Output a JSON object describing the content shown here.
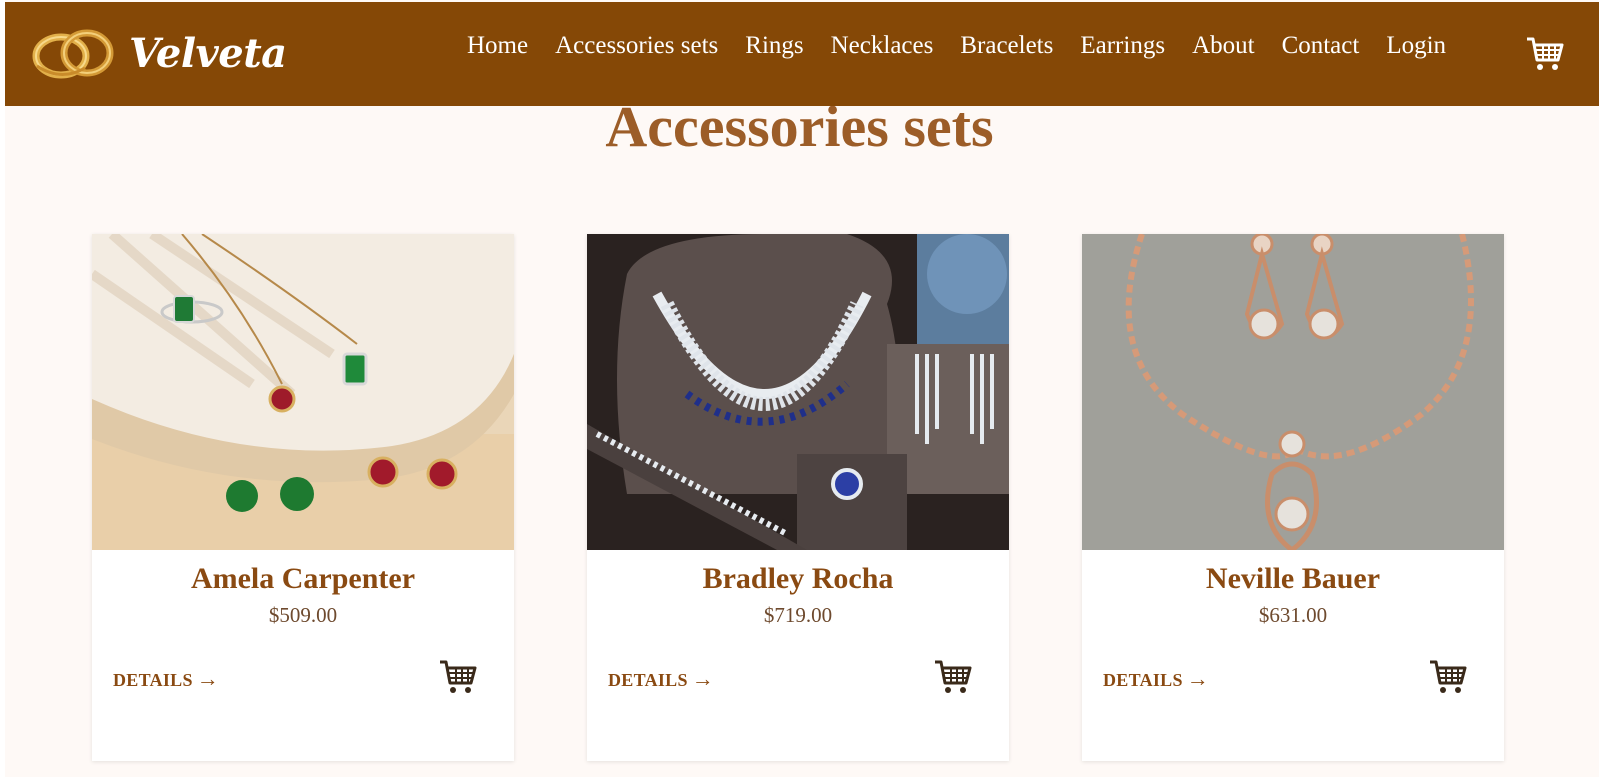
{
  "brand": {
    "name": "Velveta"
  },
  "nav": {
    "items": [
      "Home",
      "Accessories sets",
      "Rings",
      "Necklaces",
      "Bracelets",
      "Earrings",
      "About",
      "Contact",
      "Login"
    ],
    "cart_icon": "cart-icon"
  },
  "page": {
    "title": "Accessories sets"
  },
  "products": [
    {
      "name": "Amela Carpenter",
      "price": "$509.00",
      "details_label": "DETAILS",
      "arrow": "→",
      "image": "emerald-ruby-jewelry-set"
    },
    {
      "name": "Bradley Rocha",
      "price": "$719.00",
      "details_label": "DETAILS",
      "arrow": "→",
      "image": "sapphire-diamond-necklace-set"
    },
    {
      "name": "Neville Bauer",
      "price": "$631.00",
      "details_label": "DETAILS",
      "arrow": "→",
      "image": "rose-gold-crystal-necklace-set"
    }
  ],
  "colors": {
    "header_bg": "#854806",
    "page_bg": "#fef9f6",
    "title": "#9c5d28",
    "product_name": "#8a4a12",
    "price": "#6e4a2e"
  }
}
